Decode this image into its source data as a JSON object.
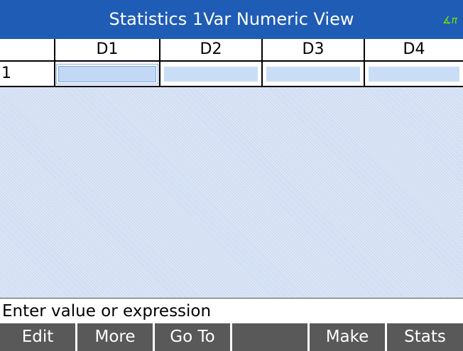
{
  "title": "Statistics 1Var Numeric View",
  "angle_indicator": "∡π",
  "columns": [
    "D1",
    "D2",
    "D3",
    "D4"
  ],
  "rows": [
    "1"
  ],
  "status_text": "Enter value or expression",
  "menu": [
    "Edit",
    "More",
    "Go To",
    "",
    "Make",
    "Stats"
  ],
  "colors": {
    "title_bar": "#1f5cb5",
    "angle_indicator": "#7fe000",
    "cell_fill": "#c9ddf6",
    "menu_key": "#595959"
  }
}
